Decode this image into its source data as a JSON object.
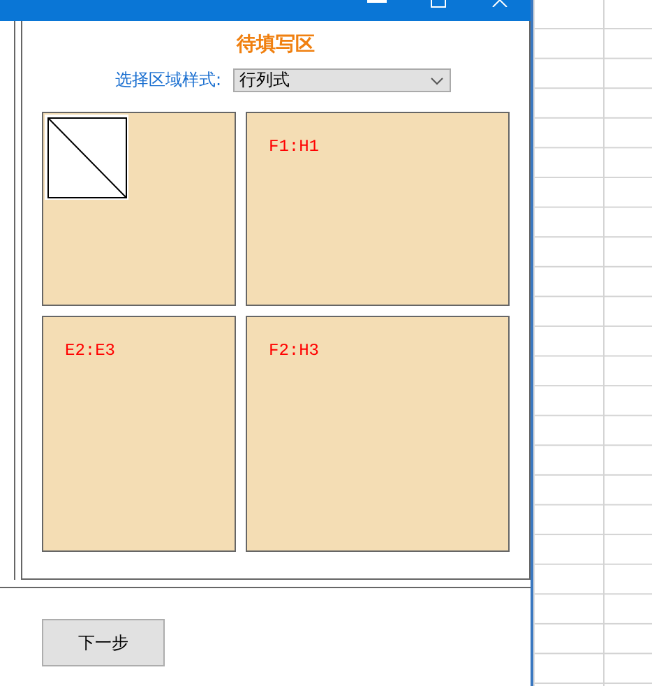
{
  "panel": {
    "title": "待填写区",
    "style_select": {
      "label": "选择区域样式:",
      "value": "行列式"
    },
    "cells": [
      {
        "kind": "corner"
      },
      {
        "kind": "range",
        "text": "F1:H1"
      },
      {
        "kind": "range",
        "text": "E2:E3"
      },
      {
        "kind": "range",
        "text": "F2:H3"
      }
    ]
  },
  "buttons": [
    {
      "label": "下一步"
    }
  ]
}
